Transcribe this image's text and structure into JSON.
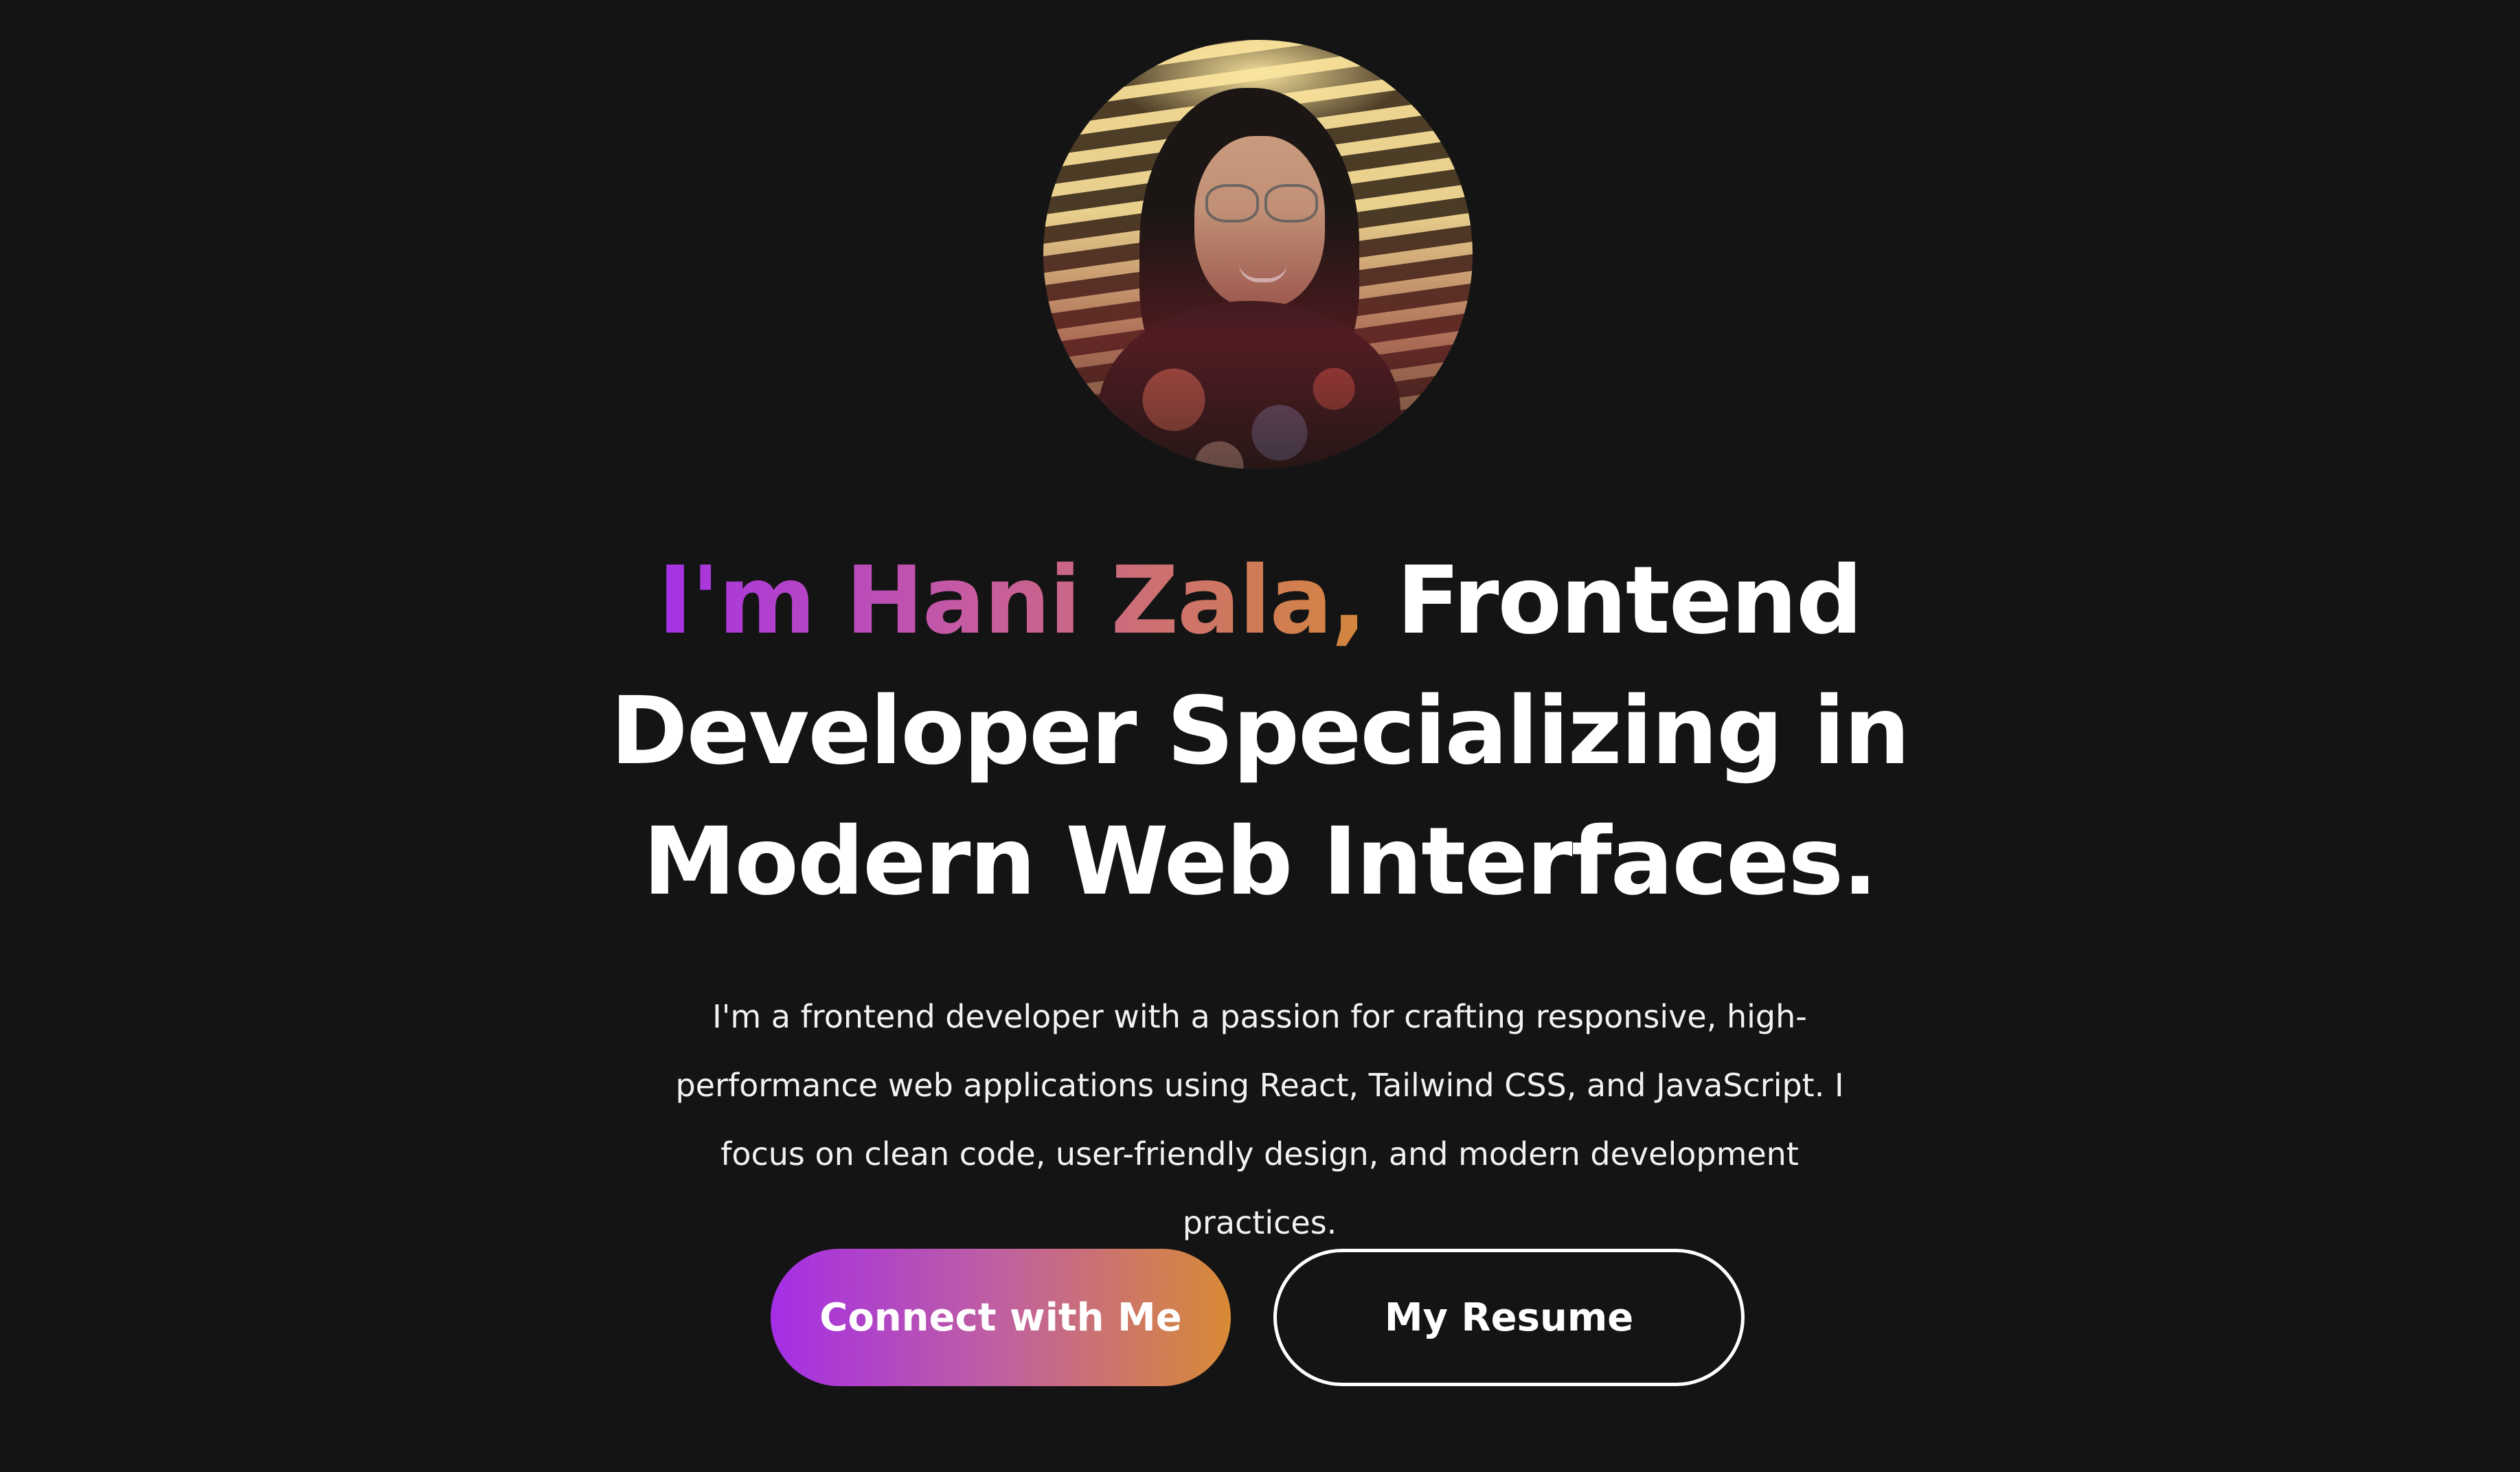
{
  "avatar": {
    "alt": "Profile photo of Hani Zala"
  },
  "hero": {
    "headline_highlight": "I'm Hani Zala,",
    "headline_rest": " Frontend Developer Specializing in Modern Web Interfaces.",
    "description": "I'm a frontend developer with a passion for crafting responsive, high-performance web applications using React, Tailwind CSS, and JavaScript. I focus on clean code, user-friendly design, and modern development practices."
  },
  "buttons": {
    "primary_label": "Connect with Me",
    "secondary_label": "My Resume"
  },
  "colors": {
    "background": "#151414",
    "gradient_start": "#a42ee6",
    "gradient_mid": "#c060a0",
    "gradient_end": "#d88a35",
    "text": "#ffffff"
  }
}
